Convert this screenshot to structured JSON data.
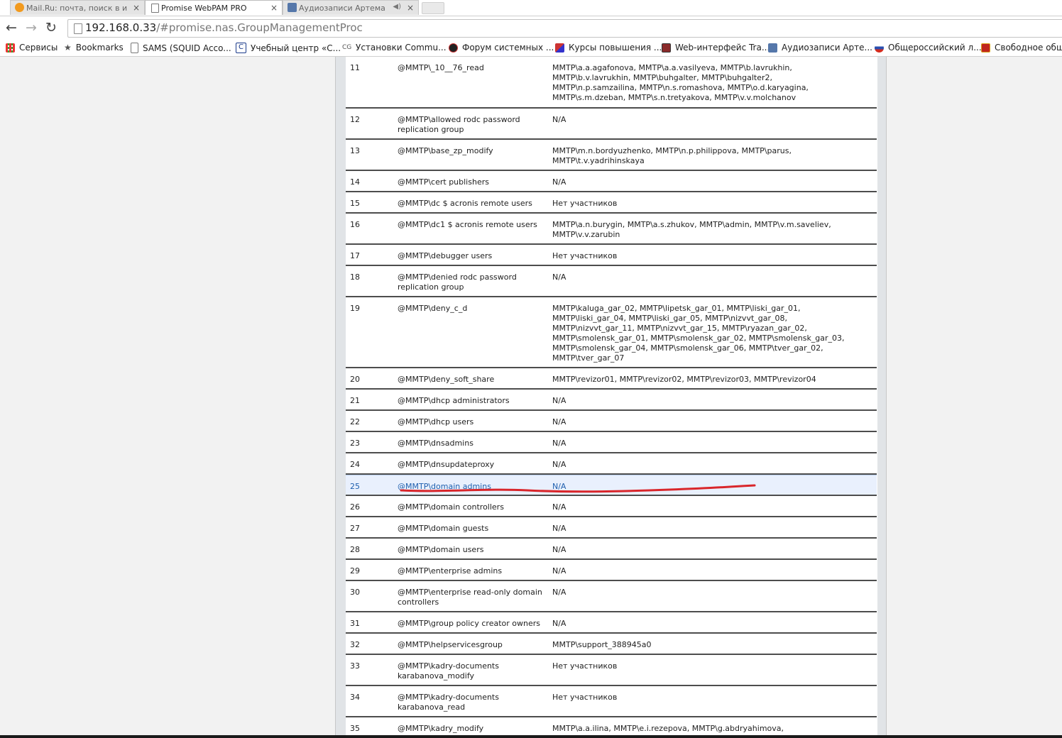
{
  "browser": {
    "tabs": [
      {
        "title": "Mail.Ru: почта, поиск в и",
        "icon": "mailru-icon",
        "active": false
      },
      {
        "title": "Promise WebPAM PRO",
        "icon": "document-icon",
        "active": true
      },
      {
        "title": "Аудиозаписи Артема",
        "icon": "audio-icon",
        "active": false
      }
    ],
    "close_glyph": "×",
    "mute_glyph": "◀)",
    "url_host": "192.168.0.33",
    "url_rest": "/#promise.nas.GroupManagementProc",
    "bookmarks": [
      {
        "label": "Сервисы",
        "icon": "apps-grid-icon"
      },
      {
        "label": "Bookmarks",
        "icon": "star-icon"
      },
      {
        "label": "SAMS (SQUID Acco...",
        "icon": "document-icon"
      },
      {
        "label": "Учебный центр «С...",
        "icon": "c-logo-icon"
      },
      {
        "label": "Установки Commu...",
        "icon": "cg-logo-icon"
      },
      {
        "label": "Форум системных ...",
        "icon": "forum-icon"
      },
      {
        "label": "Курсы повышения ...",
        "icon": "courses-icon"
      },
      {
        "label": "Web-интерфейс Tra...",
        "icon": "transmission-icon"
      },
      {
        "label": "Аудиозаписи Арте...",
        "icon": "audio-icon"
      },
      {
        "label": "Общероссийский л...",
        "icon": "globe-icon"
      },
      {
        "label": "Свободное обще",
        "icon": "emblem-icon"
      }
    ]
  },
  "colors": {
    "highlight_row": "#e9f0fd",
    "highlight_text": "#1f5fae",
    "annotation": "#d9262b"
  },
  "groups": [
    {
      "idx": "11",
      "name": "@MMTP\\_10__76_read",
      "members": [
        "MMTP\\a.a.agafonova, MMTP\\a.a.vasilyeva, MMTP\\b.lavrukhin,",
        "MMTP\\b.v.lavrukhin, MMTP\\buhgalter, MMTP\\buhgalter2,",
        "MMTP\\n.p.samzailina, MMTP\\n.s.romashova, MMTP\\o.d.karyagina,",
        "MMTP\\s.m.dzeban, MMTP\\s.n.tretyakova, MMTP\\v.v.molchanov"
      ]
    },
    {
      "idx": "12",
      "name": "@MMTP\\allowed rodc password replication group",
      "members": [
        "N/A"
      ]
    },
    {
      "idx": "13",
      "name": "@MMTP\\base_zp_modify",
      "members": [
        "MMTP\\m.n.bordyuzhenko, MMTP\\n.p.philippova, MMTP\\parus,",
        "MMTP\\t.v.yadrihinskaya"
      ]
    },
    {
      "idx": "14",
      "name": "@MMTP\\cert publishers",
      "members": [
        "N/A"
      ]
    },
    {
      "idx": "15",
      "name": "@MMTP\\dc $ acronis remote users",
      "members": [
        "Нет участников"
      ]
    },
    {
      "idx": "16",
      "name": "@MMTP\\dc1 $ acronis remote users",
      "members": [
        "MMTP\\a.n.burygin, MMTP\\a.s.zhukov, MMTP\\admin, MMTP\\v.m.saveliev,",
        "MMTP\\v.v.zarubin"
      ]
    },
    {
      "idx": "17",
      "name": "@MMTP\\debugger users",
      "members": [
        "Нет участников"
      ]
    },
    {
      "idx": "18",
      "name": "@MMTP\\denied rodc password replication group",
      "members": [
        "N/A"
      ]
    },
    {
      "idx": "19",
      "name": "@MMTP\\deny_c_d",
      "members": [
        "MMTP\\kaluga_gar_02, MMTP\\lipetsk_gar_01, MMTP\\liski_gar_01,",
        "MMTP\\liski_gar_04, MMTP\\liski_gar_05, MMTP\\nizvvt_gar_08,",
        "MMTP\\nizvvt_gar_11, MMTP\\nizvvt_gar_15, MMTP\\ryazan_gar_02,",
        "MMTP\\smolensk_gar_01, MMTP\\smolensk_gar_02, MMTP\\smolensk_gar_03,",
        "MMTP\\smolensk_gar_04, MMTP\\smolensk_gar_06, MMTP\\tver_gar_02,",
        "MMTP\\tver_gar_07"
      ]
    },
    {
      "idx": "20",
      "name": "@MMTP\\deny_soft_share",
      "members": [
        "MMTP\\revizor01, MMTP\\revizor02, MMTP\\revizor03, MMTP\\revizor04"
      ]
    },
    {
      "idx": "21",
      "name": "@MMTP\\dhcp administrators",
      "members": [
        "N/A"
      ]
    },
    {
      "idx": "22",
      "name": "@MMTP\\dhcp users",
      "members": [
        "N/A"
      ]
    },
    {
      "idx": "23",
      "name": "@MMTP\\dnsadmins",
      "members": [
        "N/A"
      ]
    },
    {
      "idx": "24",
      "name": "@MMTP\\dnsupdateproxy",
      "members": [
        "N/A"
      ]
    },
    {
      "idx": "25",
      "name": "@MMTP\\domain admins",
      "members": [
        "N/A"
      ],
      "highlighted": true
    },
    {
      "idx": "26",
      "name": "@MMTP\\domain controllers",
      "members": [
        "N/A"
      ]
    },
    {
      "idx": "27",
      "name": "@MMTP\\domain guests",
      "members": [
        "N/A"
      ]
    },
    {
      "idx": "28",
      "name": "@MMTP\\domain users",
      "members": [
        "N/A"
      ]
    },
    {
      "idx": "29",
      "name": "@MMTP\\enterprise admins",
      "members": [
        "N/A"
      ]
    },
    {
      "idx": "30",
      "name": "@MMTP\\enterprise read-only domain controllers",
      "members": [
        "N/A"
      ]
    },
    {
      "idx": "31",
      "name": "@MMTP\\group policy creator owners",
      "members": [
        "N/A"
      ]
    },
    {
      "idx": "32",
      "name": "@MMTP\\helpservicesgroup",
      "members": [
        "MMTP\\support_388945a0"
      ]
    },
    {
      "idx": "33",
      "name": "@MMTP\\kadry-documents karabanova_modify",
      "members": [
        "Нет участников"
      ]
    },
    {
      "idx": "34",
      "name": "@MMTP\\kadry-documents karabanova_read",
      "members": [
        "Нет участников"
      ]
    },
    {
      "idx": "35",
      "name": "@MMTP\\kadry_modify",
      "members": [
        "MMTP\\a.a.ilina, MMTP\\e.i.rezepova, MMTP\\g.abdryahimova,"
      ]
    }
  ]
}
